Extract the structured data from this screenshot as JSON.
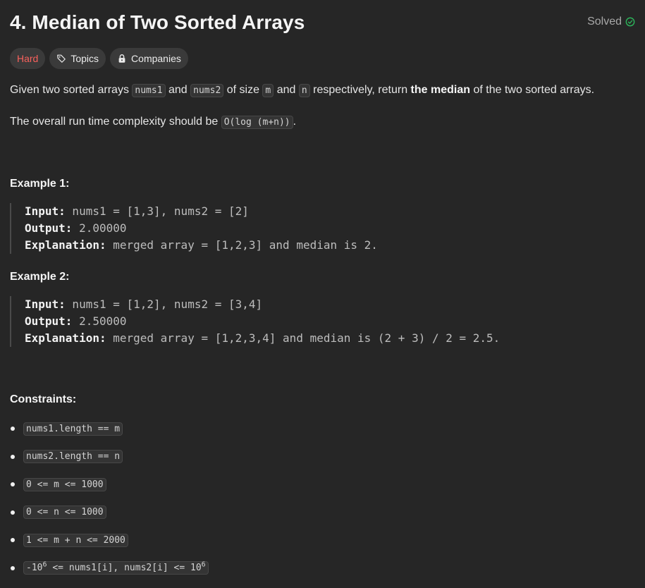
{
  "problem": {
    "title": "4. Median of Two Sorted Arrays",
    "status": "Solved",
    "tags": {
      "difficulty": "Hard",
      "topics": "Topics",
      "companies": "Companies"
    },
    "description": {
      "p1": {
        "t1": "Given two sorted arrays ",
        "c1": "nums1",
        "t2": " and ",
        "c2": "nums2",
        "t3": " of size ",
        "c3": "m",
        "t4": " and ",
        "c4": "n",
        "t5": " respectively, return ",
        "bold": "the median",
        "t6": " of the two sorted arrays."
      },
      "p2": {
        "t1": "The overall run time complexity should be ",
        "c1": "O(log (m+n))",
        "t2": "."
      }
    },
    "examples": [
      {
        "title": "Example 1:",
        "input_label": "Input:",
        "input": " nums1 = [1,3], nums2 = [2]",
        "output_label": "Output:",
        "output": " 2.00000",
        "explanation_label": "Explanation:",
        "explanation": " merged array = [1,2,3] and median is 2."
      },
      {
        "title": "Example 2:",
        "input_label": "Input:",
        "input": " nums1 = [1,2], nums2 = [3,4]",
        "output_label": "Output:",
        "output": " 2.50000",
        "explanation_label": "Explanation:",
        "explanation": " merged array = [1,2,3,4] and median is (2 + 3) / 2 = 2.5."
      }
    ],
    "constraints_title": "Constraints:",
    "constraints": [
      "nums1.length == m",
      "nums2.length == n",
      "0 <= m <= 1000",
      "0 <= n <= 1000",
      "1 <= m + n <= 2000"
    ],
    "last_constraint": {
      "a": "-10",
      "a_sup": "6",
      "b": " <= nums1[i], nums2[i] <= 10",
      "b_sup": "6"
    }
  },
  "colors": {
    "background": "#262626",
    "hard": "#f8615c",
    "solved_check": "#2cbb5d"
  },
  "icons": {
    "solved": "check-circle-icon",
    "topics": "tag-icon",
    "companies": "lock-icon"
  }
}
